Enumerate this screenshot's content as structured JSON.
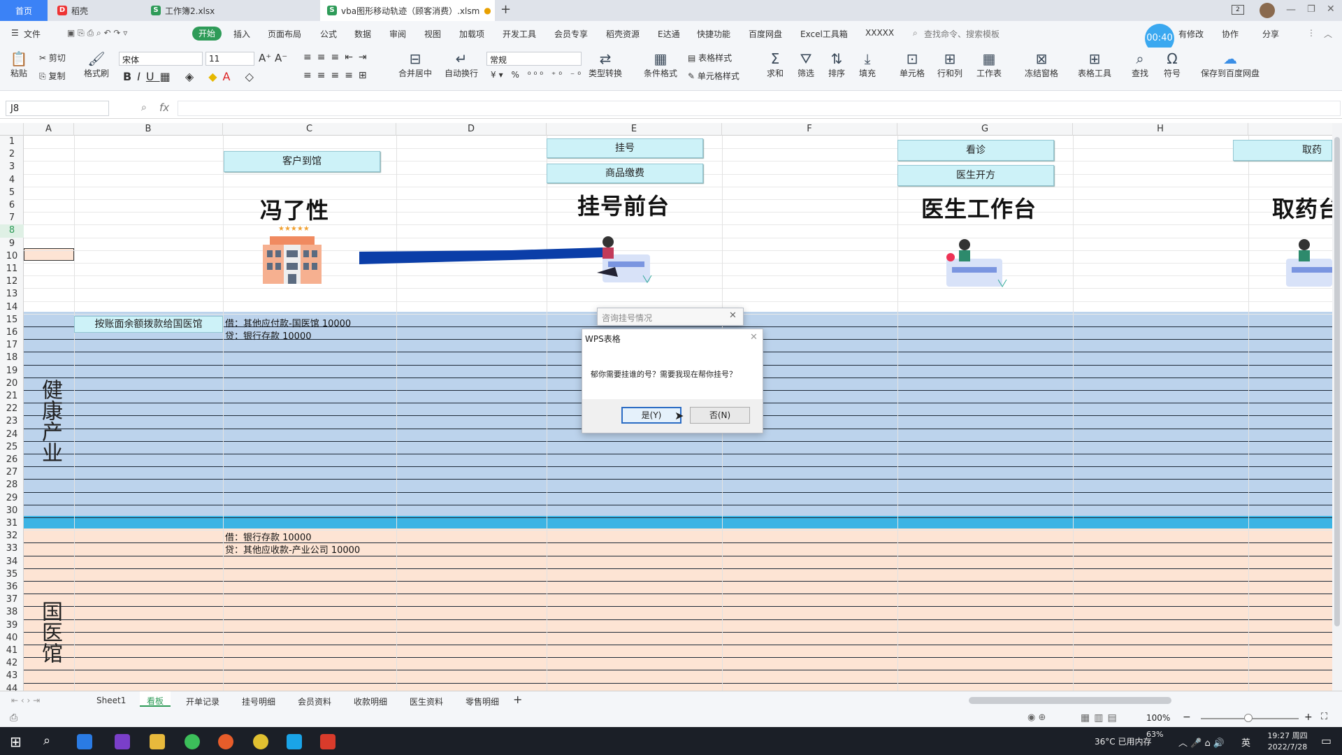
{
  "titlebar": {
    "tabs": [
      {
        "label": "首页"
      },
      {
        "label": "稻壳"
      },
      {
        "label": "工作簿2.xlsx"
      },
      {
        "label": "vba图形移动轨迹（顾客消费）.xlsm"
      }
    ],
    "new_tab": "+",
    "badge": "2"
  },
  "menu": {
    "file": "文件",
    "items": [
      "开始",
      "插入",
      "页面布局",
      "公式",
      "数据",
      "审阅",
      "视图",
      "加载项",
      "开发工具",
      "会员专享",
      "稻壳资源",
      "E达通",
      "快捷功能",
      "百度网盘",
      "Excel工具箱",
      "XXXXX"
    ],
    "search_placeholder": "查找命令、搜索模板",
    "timer": "00:40",
    "right": [
      "有修改",
      "协作",
      "分享"
    ]
  },
  "ribbon": {
    "paste": "粘贴",
    "cut": "剪切",
    "copy": "复制",
    "format_painter": "格式刷",
    "font": "宋体",
    "font_size": "11",
    "merge": "合并居中",
    "wrap": "自动换行",
    "number_format": "常规",
    "convert": "类型转换",
    "cond_format": "条件格式",
    "table_style": "表格样式",
    "cell_style": "单元格样式",
    "sum": "求和",
    "filter": "筛选",
    "sort": "排序",
    "fill": "填充",
    "cell": "单元格",
    "rowcol": "行和列",
    "worksheet": "工作表",
    "freeze": "冻结窗格",
    "table_tool": "表格工具",
    "find": "查找",
    "symbol": "符号",
    "save_baidu": "保存到百度网盘"
  },
  "formula": {
    "namebox": "J8",
    "fx": "fx",
    "value": ""
  },
  "columns": [
    "A",
    "B",
    "C",
    "D",
    "E",
    "F",
    "G",
    "H"
  ],
  "rows": [
    "1",
    "2",
    "3",
    "4",
    "5",
    "6",
    "7",
    "8",
    "9",
    "10",
    "11",
    "12",
    "13",
    "14",
    "15",
    "16",
    "17",
    "18",
    "19",
    "20",
    "21",
    "22",
    "23",
    "24",
    "25",
    "26",
    "27",
    "28",
    "29",
    "30",
    "31",
    "32",
    "33",
    "34",
    "35",
    "36",
    "37",
    "38",
    "39",
    "40",
    "41",
    "42",
    "43",
    "44"
  ],
  "sheet": {
    "btn_customer": "客户到馆",
    "btn_register": "挂号",
    "btn_goods": "商品缴费",
    "btn_diagnose": "看诊",
    "btn_prescribe": "医生开方",
    "btn_pickup": "取药",
    "title_feng": "冯了性",
    "title_front": "挂号前台",
    "title_doctor": "医生工作台",
    "title_pharmacy": "取药台",
    "b15": "按账面余额拨款给国医馆",
    "c15": "借：其他应付款-国医馆 10000",
    "c16": " 贷：银行存款 10000",
    "c32": "借：银行存款 10000",
    "c33": " 贷：其他应收款-产业公司 10000",
    "section_health": "健康产业",
    "section_clinic": "国医馆"
  },
  "dialog_bg": {
    "title": "咨询挂号情况"
  },
  "dialog": {
    "title": "WPS表格",
    "message": "郁你需要挂谁的号？需要我现在帮你挂号？",
    "yes": "是(Y)",
    "no": "否(N)"
  },
  "sheets": [
    "Sheet1",
    "看板",
    "开单记录",
    "挂号明细",
    "会员资料",
    "收款明细",
    "医生资料",
    "零售明细"
  ],
  "active_sheet": "看板",
  "status": {
    "zoom": "100%"
  },
  "taskbar": {
    "weather": "36°C 已用内存",
    "mem": "63%",
    "ime": "英",
    "time": "19:27 周四",
    "date": "2022/7/28"
  },
  "colors": {
    "accent": "#2e9b58",
    "health_band": "#bcd3ec",
    "clinic_band": "#fde4d4",
    "divider": "#3cb4e4",
    "arrow": "#0b3ea8"
  }
}
